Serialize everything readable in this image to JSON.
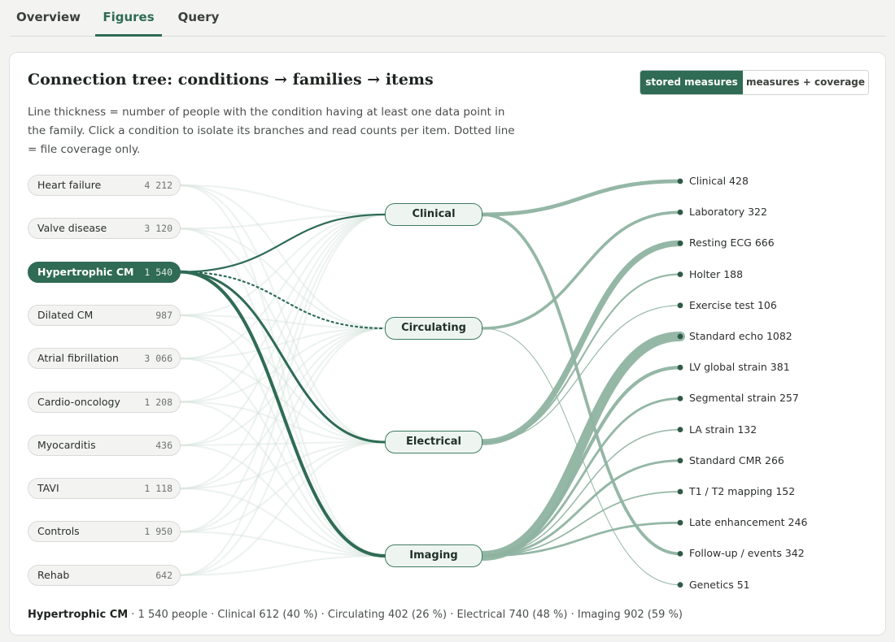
{
  "tabs": [
    {
      "label": "Overview",
      "active": false
    },
    {
      "label": "Figures",
      "active": true
    },
    {
      "label": "Query",
      "active": false
    }
  ],
  "card": {
    "title": "Connection tree: conditions → families → items",
    "description": "Line thickness = number of people with the condition having at least one data point in the family. Click a condition to isolate its branches and read counts per item. Dotted line = file coverage only.",
    "toggle": {
      "stored_label": "stored measures",
      "coverage_label": "measures + coverage",
      "active": "stored"
    }
  },
  "conditions": [
    {
      "name": "Heart failure",
      "count": "4 212"
    },
    {
      "name": "Valve disease",
      "count": "3 120"
    },
    {
      "name": "Hypertrophic CM",
      "count": "1 540",
      "selected": true
    },
    {
      "name": "Dilated CM",
      "count": "987"
    },
    {
      "name": "Atrial fibrillation",
      "count": "3 066"
    },
    {
      "name": "Cardio-oncology",
      "count": "1 208"
    },
    {
      "name": "Myocarditis",
      "count": "436"
    },
    {
      "name": "TAVI",
      "count": "1 118"
    },
    {
      "name": "Controls",
      "count": "1 950"
    },
    {
      "name": "Rehab",
      "count": "642"
    }
  ],
  "families": [
    {
      "name": "Clinical"
    },
    {
      "name": "Circulating"
    },
    {
      "name": "Electrical"
    },
    {
      "name": "Imaging"
    }
  ],
  "items": [
    {
      "label": "Clinical 428",
      "count": 428,
      "family": "Clinical"
    },
    {
      "label": "Laboratory 322",
      "count": 322,
      "family": "Circulating"
    },
    {
      "label": "Resting ECG 666",
      "count": 666,
      "family": "Electrical"
    },
    {
      "label": "Holter 188",
      "count": 188,
      "family": "Electrical"
    },
    {
      "label": "Exercise test 106",
      "count": 106,
      "family": "Electrical"
    },
    {
      "label": "Standard echo 1082",
      "count": 1082,
      "family": "Imaging"
    },
    {
      "label": "LV global strain 381",
      "count": 381,
      "family": "Imaging"
    },
    {
      "label": "Segmental strain 257",
      "count": 257,
      "family": "Imaging"
    },
    {
      "label": "LA strain 132",
      "count": 132,
      "family": "Imaging"
    },
    {
      "label": "Standard CMR 266",
      "count": 266,
      "family": "Imaging"
    },
    {
      "label": "T1 / T2 mapping 152",
      "count": 152,
      "family": "Imaging"
    },
    {
      "label": "Late enhancement 246",
      "count": 246,
      "family": "Imaging"
    },
    {
      "label": "Follow-up / events 342",
      "count": 342,
      "family": "Clinical"
    },
    {
      "label": "Genetics 51",
      "count": 51,
      "family": "Circulating"
    }
  ],
  "selected_links": [
    {
      "family": "Clinical",
      "type": "stored"
    },
    {
      "family": "Circulating",
      "type": "coverage"
    },
    {
      "family": "Electrical",
      "type": "stored"
    },
    {
      "family": "Imaging",
      "type": "stored"
    }
  ],
  "footer": {
    "selected_name": "Hypertrophic CM",
    "summary": " · 1 540 people · Clinical 612 (40 %) · Circulating 402 (26 %) · Electrical 740 (48 %) · Imaging 902 (59 %)"
  },
  "colors": {
    "accent": "#2f6b55",
    "link_item": "#8fb3a1",
    "link_bg": "#d8e5de"
  }
}
